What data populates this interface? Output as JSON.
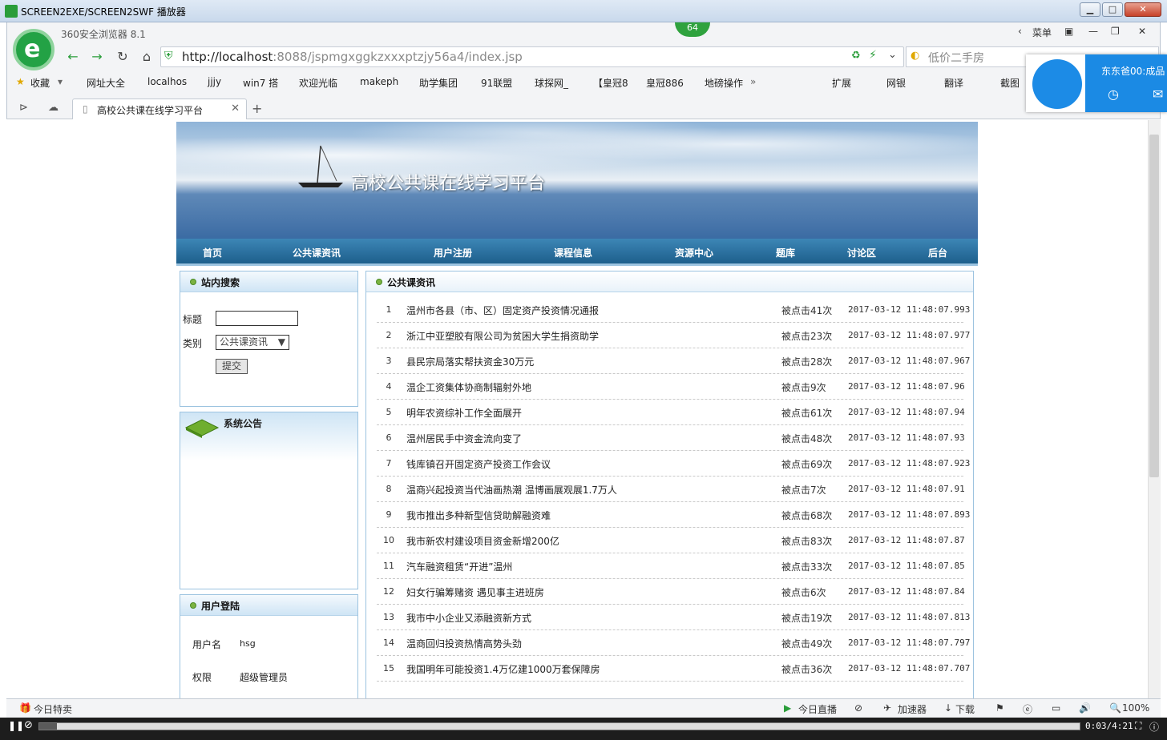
{
  "player": {
    "title": "SCREEN2EXE/SCREEN2SWF 播放器",
    "time": "0:03/4:21"
  },
  "browser": {
    "name": "360安全浏览器 8.1",
    "badge": "64",
    "menu_label": "菜单",
    "url_host": "http://localhost",
    "url_rest": ":8088/jspmgxggkzxxxptzjy56a4/index.jsp",
    "search_placeholder": "低价二手房",
    "bookmarks": [
      "收藏",
      "网址大全",
      "localhos",
      "jjjy",
      "win7 搭",
      "欢迎光临",
      "makeph",
      "助学集团",
      "91联盟",
      "球探网_",
      "【皇冠8",
      "皇冠886",
      "地磅操作"
    ],
    "extensions": [
      "扩展",
      "网银",
      "翻译",
      "截图"
    ],
    "tab_title": "高校公共课在线学习平台",
    "popup_name": "东东爸00:成品"
  },
  "site": {
    "title": "高校公共课在线学习平台",
    "nav": [
      "首页",
      "公共课资讯",
      "用户注册",
      "课程信息",
      "资源中心",
      "题库",
      "讨论区",
      "后台"
    ],
    "search_panel": {
      "title": "站内搜索",
      "label_title": "标题",
      "label_type": "类别",
      "type_value": "公共课资讯",
      "submit": "提交"
    },
    "notice_panel": {
      "title": "系统公告"
    },
    "login_panel": {
      "title": "用户登陆",
      "user_label": "用户名",
      "user_value": "hsg",
      "role_label": "权限",
      "role_value": "超级管理员"
    },
    "news": {
      "title": "公共课资讯",
      "items": [
        {
          "n": "1",
          "title": "温州市各县（市、区）固定资产投资情况通报",
          "clicks": "被点击41次",
          "date": "2017-03-12 11:48:07.993"
        },
        {
          "n": "2",
          "title": "浙江中亚塑胶有限公司为贫困大学生捐资助学",
          "clicks": "被点击23次",
          "date": "2017-03-12 11:48:07.977"
        },
        {
          "n": "3",
          "title": "县民宗局落实帮扶资金30万元",
          "clicks": "被点击28次",
          "date": "2017-03-12 11:48:07.967"
        },
        {
          "n": "4",
          "title": "温企工资集体协商制辐射外地",
          "clicks": "被点击9次",
          "date": "2017-03-12 11:48:07.96"
        },
        {
          "n": "5",
          "title": "明年农资综补工作全面展开",
          "clicks": "被点击61次",
          "date": "2017-03-12 11:48:07.94"
        },
        {
          "n": "6",
          "title": "温州居民手中资金流向变了",
          "clicks": "被点击48次",
          "date": "2017-03-12 11:48:07.93"
        },
        {
          "n": "7",
          "title": "钱库镇召开固定资产投资工作会议",
          "clicks": "被点击69次",
          "date": "2017-03-12 11:48:07.923"
        },
        {
          "n": "8",
          "title": "温商兴起投资当代油画热潮 温博画展观展1.7万人",
          "clicks": "被点击7次",
          "date": "2017-03-12 11:48:07.91"
        },
        {
          "n": "9",
          "title": "我市推出多种新型信贷助解融资难",
          "clicks": "被点击68次",
          "date": "2017-03-12 11:48:07.893"
        },
        {
          "n": "10",
          "title": "我市新农村建设项目资金新增200亿",
          "clicks": "被点击83次",
          "date": "2017-03-12 11:48:07.87"
        },
        {
          "n": "11",
          "title": "汽车融资租赁“开进”温州",
          "clicks": "被点击33次",
          "date": "2017-03-12 11:48:07.85"
        },
        {
          "n": "12",
          "title": "妇女行骗筹赌资 遇见事主进班房",
          "clicks": "被点击6次",
          "date": "2017-03-12 11:48:07.84"
        },
        {
          "n": "13",
          "title": "我市中小企业又添融资新方式",
          "clicks": "被点击19次",
          "date": "2017-03-12 11:48:07.813"
        },
        {
          "n": "14",
          "title": "温商回归投资热情高势头劲",
          "clicks": "被点击49次",
          "date": "2017-03-12 11:48:07.797"
        },
        {
          "n": "15",
          "title": "我国明年可能投资1.4万亿建1000万套保障房",
          "clicks": "被点击36次",
          "date": "2017-03-12 11:48:07.707"
        }
      ]
    }
  },
  "status": {
    "left": "今日特卖",
    "live": "今日直播",
    "speed": "加速器",
    "download": "下载",
    "zoom": "100%"
  }
}
